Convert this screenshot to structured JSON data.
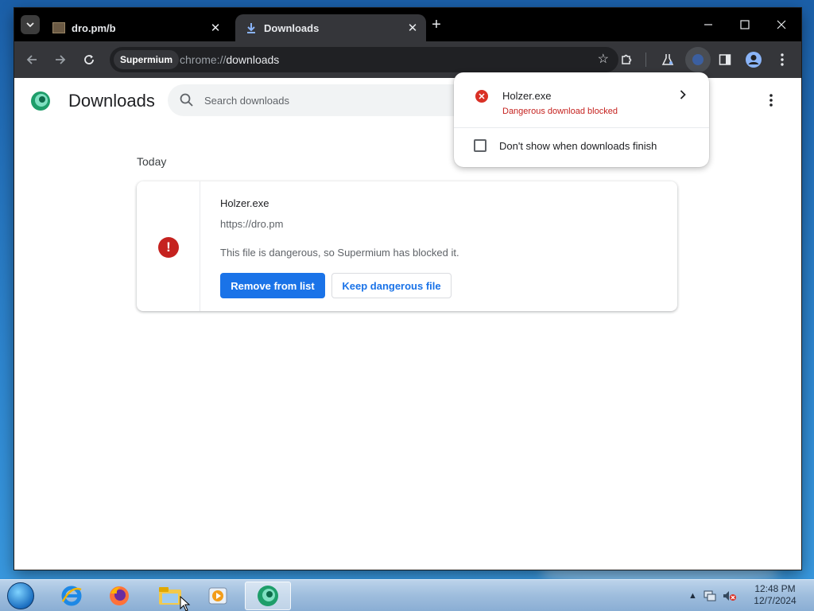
{
  "browser": {
    "tabs": [
      {
        "title": "dro.pm/b",
        "active": false
      },
      {
        "title": "Downloads",
        "active": true
      }
    ],
    "omnibox": {
      "chip": "Supermium",
      "url_scheme": "chrome://",
      "url_path": "downloads"
    }
  },
  "downloads_page": {
    "title": "Downloads",
    "search_placeholder": "Search downloads",
    "section_label": "Today",
    "item": {
      "file_name": "Holzer.exe",
      "url": "https://dro.pm",
      "description": "This file is dangerous, so Supermium has blocked it.",
      "primary_button": "Remove from list",
      "secondary_button": "Keep dangerous file"
    }
  },
  "download_bubble": {
    "file_name": "Holzer.exe",
    "status": "Dangerous download blocked",
    "checkbox_label": "Don't show when downloads finish",
    "checkbox_checked": false
  },
  "taskbar": {
    "apps": [
      "internet-explorer",
      "firefox",
      "file-explorer",
      "media-player",
      "supermium"
    ],
    "clock_time": "12:48 PM",
    "clock_date": "12/7/2024"
  },
  "colors": {
    "accent": "#1a73e8",
    "danger": "#c5221f",
    "toolbar": "#35363a"
  }
}
